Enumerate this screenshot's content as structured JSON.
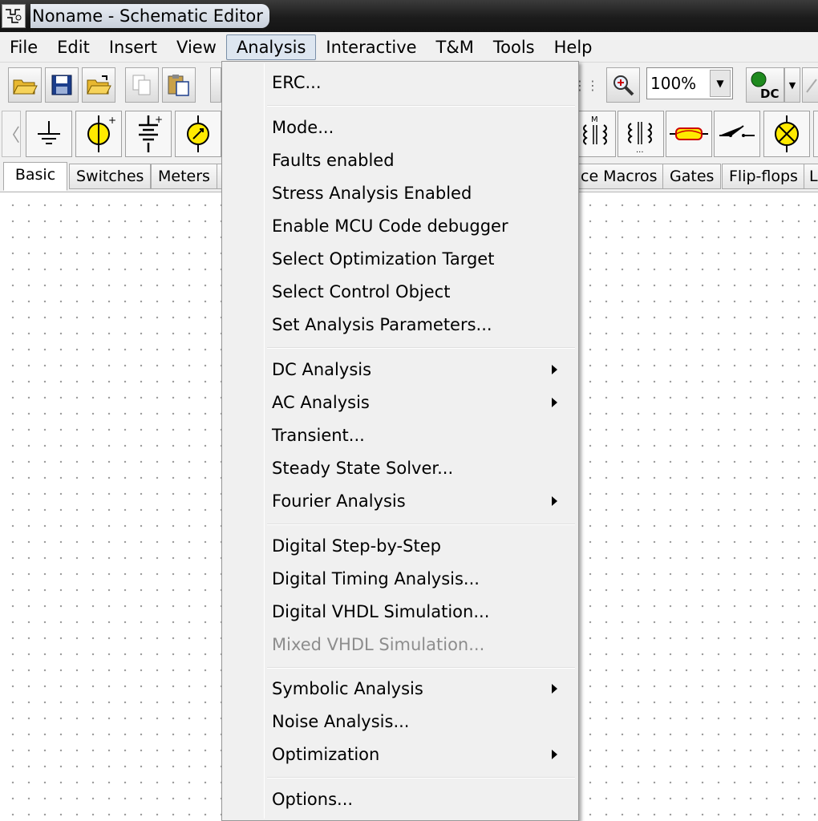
{
  "window": {
    "title": "Noname - Schematic Editor"
  },
  "menubar": {
    "items": [
      "File",
      "Edit",
      "Insert",
      "View",
      "Analysis",
      "Interactive",
      "T&M",
      "Tools",
      "Help"
    ],
    "active": "Analysis"
  },
  "toolbar": {
    "zoom": "100%",
    "buttons": [
      "open-folder-icon",
      "save-icon",
      "open-project-icon",
      "copy-icon",
      "paste-icon",
      "zoom-in-icon",
      "dc-analysis-icon"
    ]
  },
  "palette": {
    "components": [
      "ground-icon",
      "voltage-source-icon",
      "battery-icon",
      "current-source-icon",
      "transformer-icon",
      "coupled-inductor-icon",
      "fuse-icon",
      "switch-icon",
      "lamp-icon"
    ]
  },
  "tabs": {
    "items": [
      "Basic",
      "Switches",
      "Meters",
      "ce Macros",
      "Gates",
      "Flip-flops",
      "L"
    ],
    "selected": "Basic"
  },
  "analysis_menu": {
    "items": [
      {
        "label": "ERC...",
        "submenu": false,
        "enabled": true
      },
      {
        "label": "Mode...",
        "submenu": false,
        "enabled": true
      },
      {
        "label": "Faults enabled",
        "submenu": false,
        "enabled": true
      },
      {
        "label": "Stress Analysis Enabled",
        "submenu": false,
        "enabled": true
      },
      {
        "label": "Enable MCU Code debugger",
        "submenu": false,
        "enabled": true
      },
      {
        "label": "Select Optimization Target",
        "submenu": false,
        "enabled": true
      },
      {
        "label": "Select Control Object",
        "submenu": false,
        "enabled": true
      },
      {
        "label": "Set Analysis Parameters...",
        "submenu": false,
        "enabled": true
      },
      {
        "label": "DC Analysis",
        "submenu": true,
        "enabled": true
      },
      {
        "label": "AC Analysis",
        "submenu": true,
        "enabled": true
      },
      {
        "label": "Transient...",
        "submenu": false,
        "enabled": true
      },
      {
        "label": "Steady State Solver...",
        "submenu": false,
        "enabled": true
      },
      {
        "label": "Fourier Analysis",
        "submenu": true,
        "enabled": true
      },
      {
        "label": "Digital Step-by-Step",
        "submenu": false,
        "enabled": true
      },
      {
        "label": "Digital Timing Analysis...",
        "submenu": false,
        "enabled": true
      },
      {
        "label": "Digital VHDL Simulation...",
        "submenu": false,
        "enabled": true
      },
      {
        "label": "Mixed VHDL Simulation...",
        "submenu": false,
        "enabled": false
      },
      {
        "label": "Symbolic Analysis",
        "submenu": true,
        "enabled": true
      },
      {
        "label": "Noise Analysis...",
        "submenu": false,
        "enabled": true
      },
      {
        "label": "Optimization",
        "submenu": true,
        "enabled": true
      },
      {
        "label": "Options...",
        "submenu": false,
        "enabled": true
      }
    ]
  },
  "colors": {
    "menu_bg": "#f0f0f0",
    "titlebar": "#1c1c1c",
    "disabled_text": "#8d8d8d"
  }
}
